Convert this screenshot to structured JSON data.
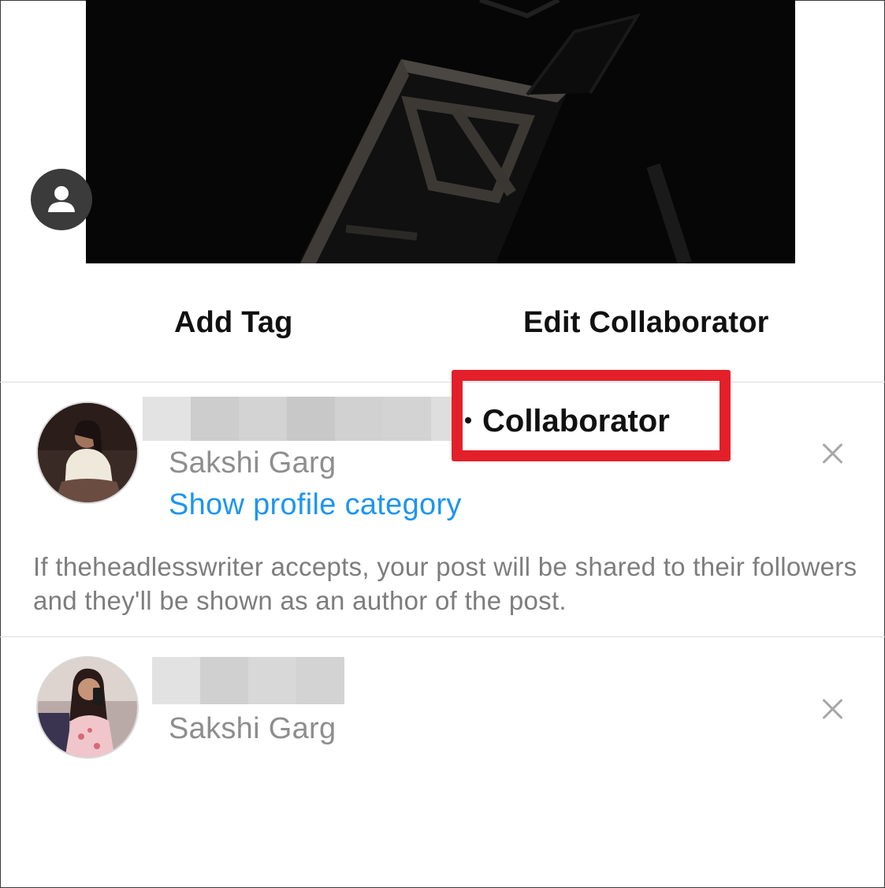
{
  "photo": {
    "tag_people_icon": "person-icon"
  },
  "actions": {
    "add_tag_label": "Add Tag",
    "edit_collaborator_label": "Edit Collaborator"
  },
  "collaborators": [
    {
      "full_name": "Sakshi Garg",
      "role": "Collaborator",
      "category_link": "Show profile category",
      "note": "If theheadlesswriter accepts, your post will be shared to their followers and they'll be shown as an author of the post.",
      "remove_icon": "close-icon"
    },
    {
      "full_name": "Sakshi Garg",
      "remove_icon": "close-icon"
    }
  ],
  "colors": {
    "link": "#1e95f0",
    "highlight": "#e3202a",
    "secondary_text": "#8e8e8e"
  }
}
